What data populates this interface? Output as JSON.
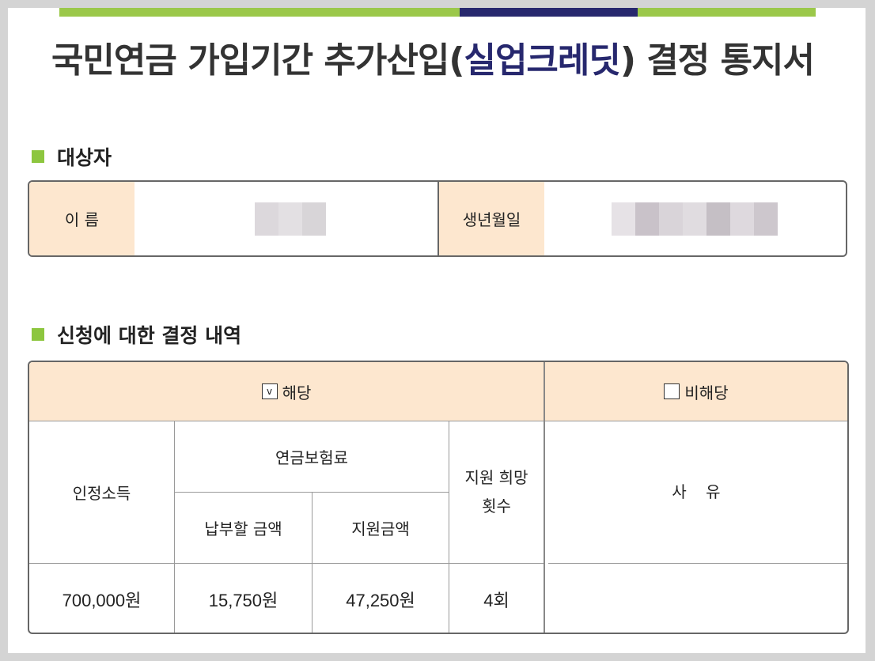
{
  "title": {
    "main": "국민연금 가입기간 추가산입(",
    "highlight": "실업크레딧",
    ") ": "",
    "suffix": ") 결정 통지서"
  },
  "section1": {
    "heading": "대상자",
    "name_label": "이 름",
    "birth_label": "생년월일"
  },
  "section2": {
    "heading": "신청에 대한 결정 내역",
    "applicable": {
      "check": "v",
      "label": "해당"
    },
    "not_applicable": {
      "check": "",
      "label": "비해당"
    },
    "columns": {
      "income": "인정소득",
      "premium": "연금보험료",
      "payable": "납부할 금액",
      "support": "지원금액",
      "wish_line1": "지원 희망",
      "wish_line2": "횟수",
      "reason": "사 유"
    },
    "values": {
      "income": "700,000원",
      "payable": "15,750원",
      "support": "47,250원",
      "count": "4회",
      "reason": ""
    }
  },
  "colors": {
    "accent_green": "#9bc84a",
    "accent_navy": "#27286e",
    "header_bg": "#fde7cf"
  }
}
